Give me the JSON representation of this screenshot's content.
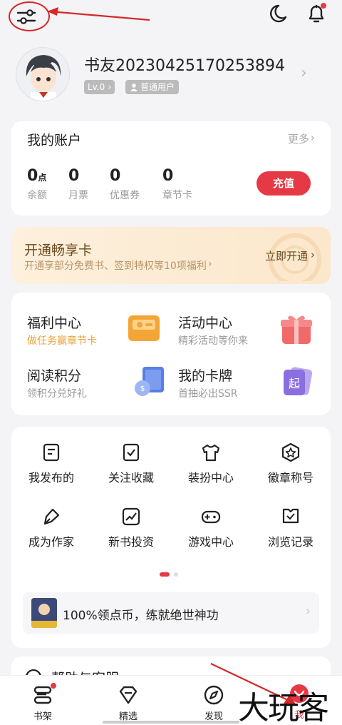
{
  "profile": {
    "username": "书友20230425170253894",
    "level": "Lv.0",
    "user_type": "普通用户"
  },
  "account": {
    "title": "我的账户",
    "more": "更多",
    "stats": [
      {
        "value": "0",
        "unit": "点",
        "label": "余额"
      },
      {
        "value": "0",
        "unit": "",
        "label": "月票"
      },
      {
        "value": "0",
        "unit": "",
        "label": "优惠券"
      },
      {
        "value": "0",
        "unit": "",
        "label": "章节卡"
      }
    ],
    "recharge": "充值"
  },
  "vip": {
    "title": "开通畅享卡",
    "desc": "开通享部分免费书、签到特权等10项福利",
    "action": "立即开通"
  },
  "features": [
    {
      "title": "福利中心",
      "sub": "做任务赢章节卡",
      "icon": "coupon-icon"
    },
    {
      "title": "活动中心",
      "sub": "精彩活动等你来",
      "icon": "gift-icon"
    },
    {
      "title": "阅读积分",
      "sub": "领积分兑好礼",
      "icon": "book-coin-icon"
    },
    {
      "title": "我的卡牌",
      "sub": "首抽必出SSR",
      "icon": "card-icon"
    }
  ],
  "grid": [
    {
      "label": "我发布的",
      "icon": "document-icon"
    },
    {
      "label": "关注收藏",
      "icon": "bookmark-check-icon"
    },
    {
      "label": "装扮中心",
      "icon": "shirt-icon"
    },
    {
      "label": "徽章称号",
      "icon": "badge-star-icon"
    },
    {
      "label": "成为作家",
      "icon": "pen-icon"
    },
    {
      "label": "新书投资",
      "icon": "trend-chart-icon"
    },
    {
      "label": "游戏中心",
      "icon": "gamepad-icon"
    },
    {
      "label": "浏览记录",
      "icon": "history-icon"
    }
  ],
  "promo": {
    "text": "100%领点币，练就绝世神功"
  },
  "help": {
    "title": "帮助与客服"
  },
  "tabbar": [
    {
      "label": "书架",
      "icon": "bookshelf-icon"
    },
    {
      "label": "精选",
      "icon": "diamond-icon"
    },
    {
      "label": "发现",
      "icon": "compass-icon"
    },
    {
      "label": "我",
      "icon": "me-icon"
    }
  ],
  "watermark": "大玩客",
  "colors": {
    "accent": "#e63946",
    "gold": "#e8a33a",
    "vip_bg": "#fdf0dc",
    "annotation": "#d62828"
  }
}
